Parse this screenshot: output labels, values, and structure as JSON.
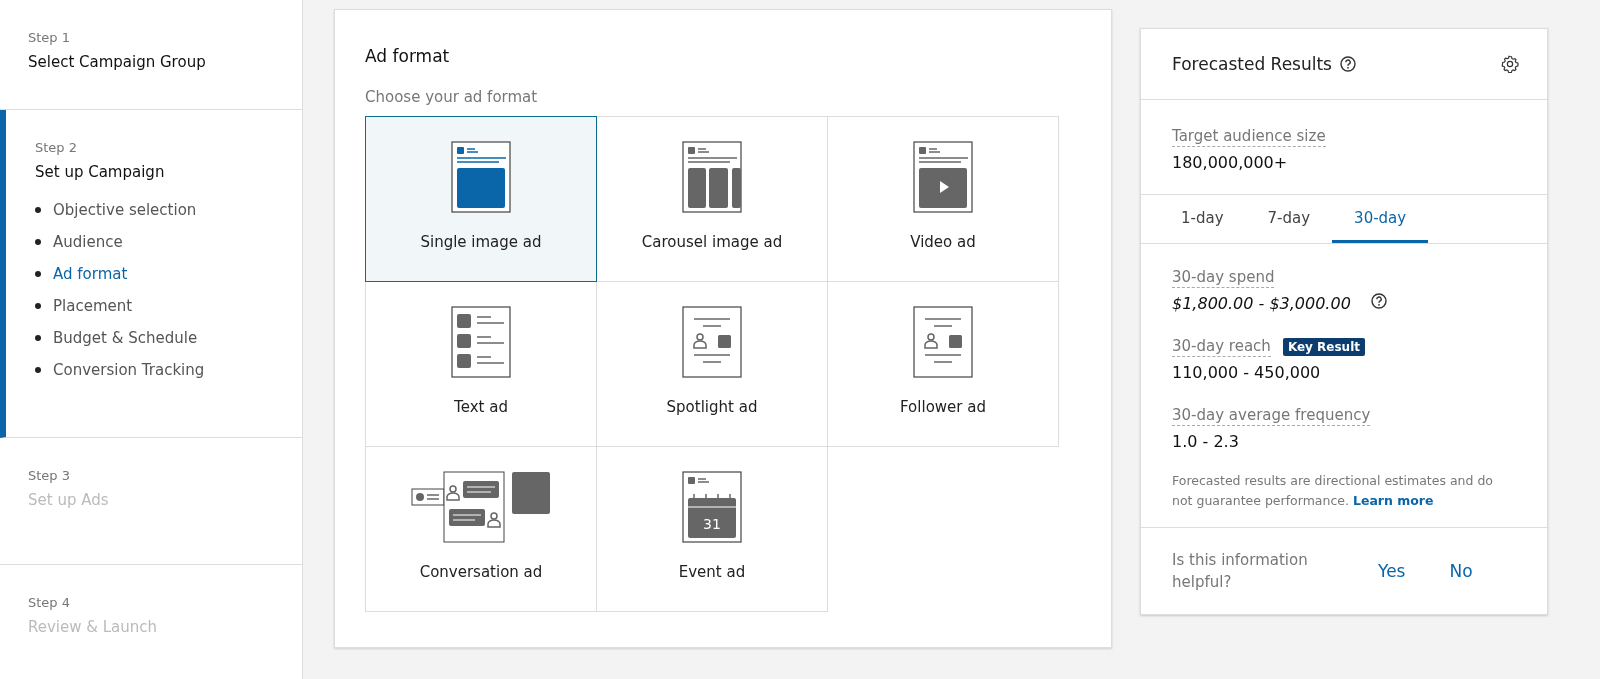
{
  "steps": [
    {
      "step": "Step 1",
      "title": "Select Campaign Group",
      "active": false,
      "disabled": false
    },
    {
      "step": "Step 2",
      "title": "Set up Campaign",
      "active": true,
      "disabled": false,
      "substeps": [
        {
          "label": "Objective selection",
          "selected": false
        },
        {
          "label": "Audience",
          "selected": false
        },
        {
          "label": "Ad format",
          "selected": true
        },
        {
          "label": "Placement",
          "selected": false
        },
        {
          "label": "Budget & Schedule",
          "selected": false
        },
        {
          "label": "Conversion Tracking",
          "selected": false
        }
      ]
    },
    {
      "step": "Step 3",
      "title": "Set up Ads",
      "active": false,
      "disabled": true
    },
    {
      "step": "Step 4",
      "title": "Review & Launch",
      "active": false,
      "disabled": true
    }
  ],
  "ad_format": {
    "title": "Ad format",
    "subtitle": "Choose your ad format",
    "formats": [
      {
        "kind": "single",
        "label": "Single image ad",
        "selected": true
      },
      {
        "kind": "carousel",
        "label": "Carousel image ad",
        "selected": false
      },
      {
        "kind": "video",
        "label": "Video ad",
        "selected": false
      },
      {
        "kind": "text",
        "label": "Text ad",
        "selected": false
      },
      {
        "kind": "spotlight",
        "label": "Spotlight ad",
        "selected": false
      },
      {
        "kind": "follower",
        "label": "Follower ad",
        "selected": false
      },
      {
        "kind": "conversation",
        "label": "Conversation ad",
        "selected": false
      },
      {
        "kind": "event",
        "label": "Event ad",
        "selected": false,
        "calendar_day": "31"
      }
    ]
  },
  "forecast": {
    "title": "Forecasted Results",
    "audience_label": "Target audience size",
    "audience_value": "180,000,000+",
    "tabs": [
      {
        "label": "1-day",
        "selected": false
      },
      {
        "label": "7-day",
        "selected": false
      },
      {
        "label": "30-day",
        "selected": true
      }
    ],
    "metrics": [
      {
        "label": "30-day spend",
        "value": "$1,800.00 - $3,000.00",
        "italic": true,
        "help": true
      },
      {
        "label": "30-day reach",
        "value": "110,000 - 450,000",
        "italic": false,
        "help": false,
        "badge": "Key Result"
      },
      {
        "label": "30-day average frequency",
        "value": "1.0 - 2.3",
        "italic": false,
        "help": false
      }
    ],
    "disclaimer": "Forecasted results are directional estimates and do not guarantee performance.",
    "learn_more": "Learn more",
    "feedback_question": "Is this information helpful?",
    "feedback_buttons": [
      "Yes",
      "No"
    ]
  }
}
